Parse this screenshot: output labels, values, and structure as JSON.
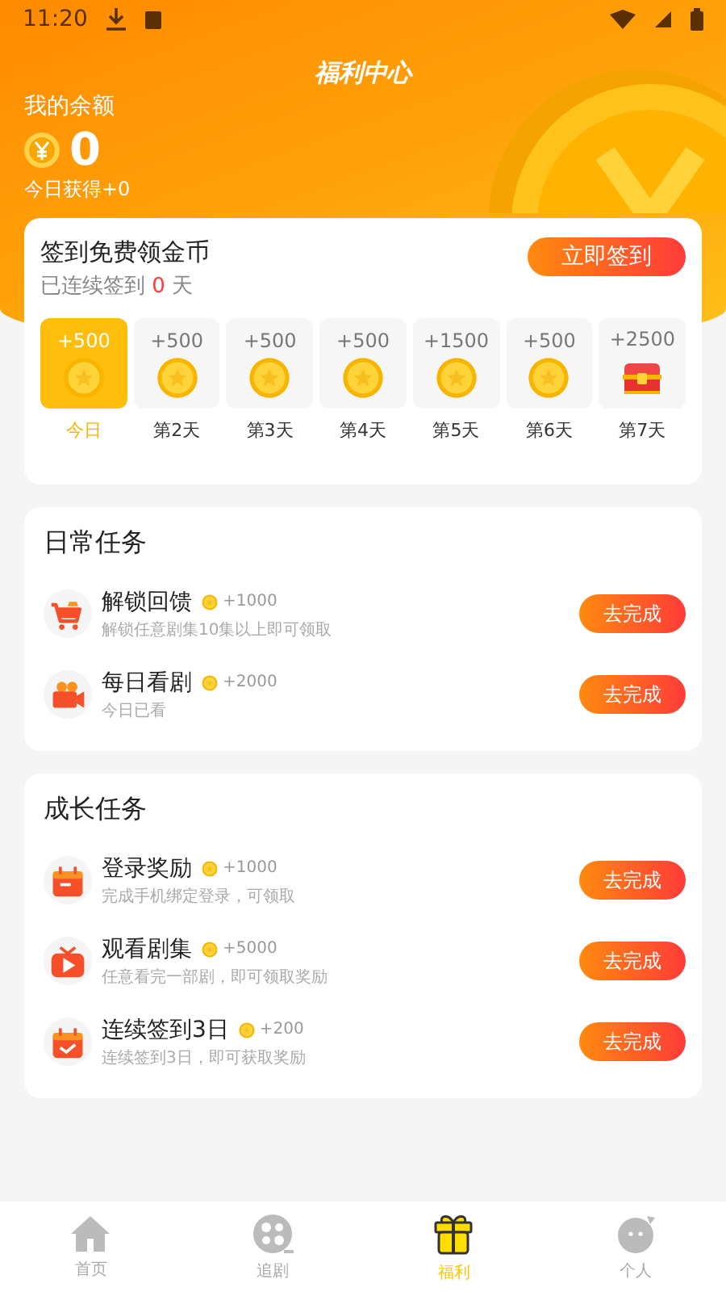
{
  "status_bar": {
    "time": "11:20"
  },
  "header": {
    "title": "福利中心",
    "balance_label": "我的余额",
    "balance": "0",
    "today_earned": "今日获得+0"
  },
  "checkin": {
    "title": "签到免费领金币",
    "streak_prefix": "已连续签到",
    "streak_count": "0",
    "streak_suffix": "天",
    "button": "立即签到",
    "days": [
      {
        "reward": "+500",
        "label": "今日",
        "kind": "coin",
        "selected": true
      },
      {
        "reward": "+500",
        "label": "第2天",
        "kind": "coin",
        "selected": false
      },
      {
        "reward": "+500",
        "label": "第3天",
        "kind": "coin",
        "selected": false
      },
      {
        "reward": "+500",
        "label": "第4天",
        "kind": "coin",
        "selected": false
      },
      {
        "reward": "+1500",
        "label": "第5天",
        "kind": "coin",
        "selected": false
      },
      {
        "reward": "+500",
        "label": "第6天",
        "kind": "coin",
        "selected": false
      },
      {
        "reward": "+2500",
        "label": "第7天",
        "kind": "chest",
        "selected": false
      }
    ]
  },
  "task_groups": [
    {
      "title": "日常任务",
      "tasks": [
        {
          "kind": "cart",
          "name": "解锁回馈",
          "reward": "+1000",
          "desc": "解锁任意剧集10集以上即可领取",
          "button": "去完成"
        },
        {
          "kind": "camera",
          "name": "每日看剧",
          "reward": "+2000",
          "desc": "今日已看",
          "button": "去完成"
        }
      ]
    },
    {
      "title": "成长任务",
      "tasks": [
        {
          "kind": "calendar",
          "name": "登录奖励",
          "reward": "+1000",
          "desc": "完成手机绑定登录，可领取",
          "button": "去完成"
        },
        {
          "kind": "tv",
          "name": "观看剧集",
          "reward": "+5000",
          "desc": "任意看完一部剧，即可领取奖励",
          "button": "去完成"
        },
        {
          "kind": "calendar-check",
          "name": "连续签到3日",
          "reward": "+200",
          "desc": "连续签到3日，即可获取奖励",
          "button": "去完成"
        }
      ]
    }
  ],
  "tab_bar": [
    {
      "label": "首页",
      "kind": "home",
      "selected": false
    },
    {
      "label": "追剧",
      "kind": "film",
      "selected": false
    },
    {
      "label": "福利",
      "kind": "gift",
      "selected": true
    },
    {
      "label": "个人",
      "kind": "person",
      "selected": false
    }
  ]
}
